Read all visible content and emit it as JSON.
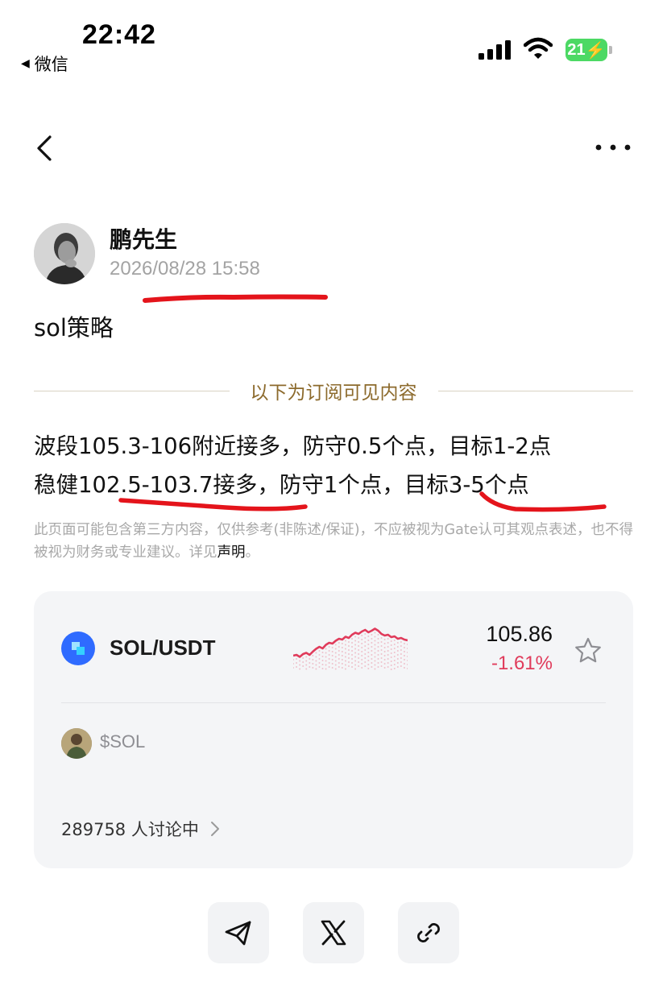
{
  "status_bar": {
    "time": "22:42",
    "back_app": "微信",
    "battery": "21"
  },
  "nav": {
    "back_icon": "chevron-left-icon",
    "more_icon": "more-horizontal-icon"
  },
  "author": {
    "name": "鹏先生",
    "time": "2026/08/28 15:58"
  },
  "post": {
    "title": "sol策略",
    "divider_text": "以下为订阅可见内容",
    "lines": [
      "波段105.3-106附近接多，防守0.5个点，目标1-2点",
      "稳健102.5-103.7接多，防守1个点，目标3-5个点"
    ],
    "disclaimer": "此页面可能包含第三方内容，仅供参考(非陈述/保证)，不应被视为Gate认可其观点表述，也不得被视为财务或专业建议。详见",
    "disclaimer_link": "声明",
    "disclaimer_end": "。"
  },
  "ticker": {
    "pair": "SOL/USDT",
    "price": "105.86",
    "change": "-1.61%",
    "trend_color": "#e03b5b",
    "sparkline": [
      0.28,
      0.3,
      0.25,
      0.32,
      0.35,
      0.3,
      0.38,
      0.45,
      0.5,
      0.46,
      0.55,
      0.6,
      0.58,
      0.65,
      0.7,
      0.68,
      0.75,
      0.72,
      0.8,
      0.85,
      0.82,
      0.88,
      0.92,
      0.86,
      0.9,
      0.95,
      0.9,
      0.82,
      0.78,
      0.8,
      0.74,
      0.76,
      0.7,
      0.72,
      0.68,
      0.66
    ],
    "tag": "$SOL",
    "discussion": "289758 人讨论中"
  },
  "share": {
    "icons": [
      "send-icon",
      "x-logo-icon",
      "link-icon"
    ]
  },
  "colors": {
    "accent_gold": "#8c6a2c",
    "coin_blue": "#2f6bff",
    "annotation_red": "#e4141b"
  }
}
